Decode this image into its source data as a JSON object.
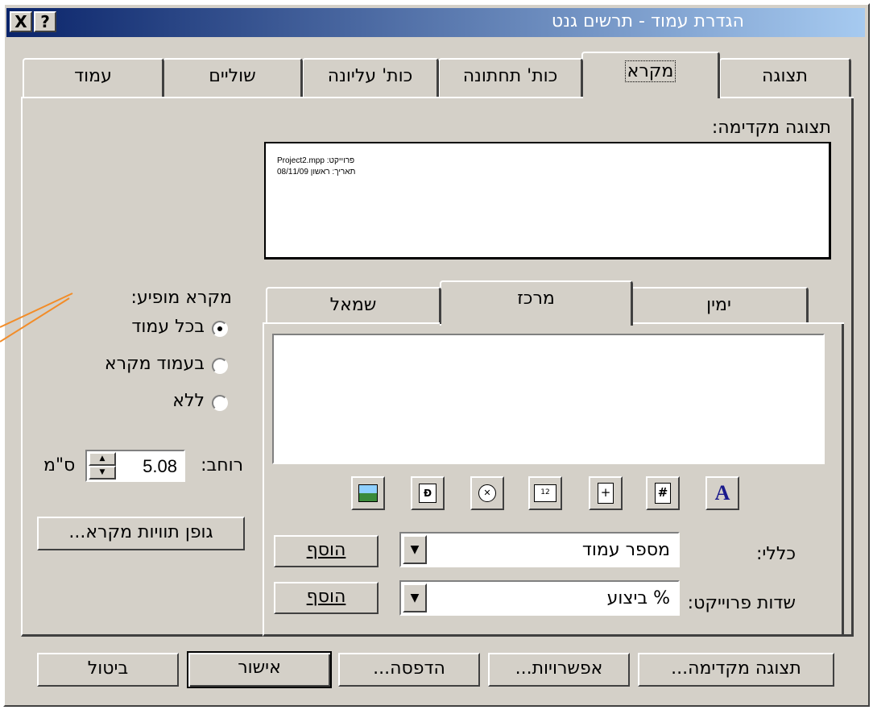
{
  "window": {
    "title": "הגדרת עמוד - תרשים גנט",
    "help_label": "?",
    "close_label": "X"
  },
  "tabs": [
    {
      "label": "תצוגה",
      "active": false
    },
    {
      "label": "מקרא",
      "active": true
    },
    {
      "label": "כות' תחתונה",
      "active": false
    },
    {
      "label": "כות' עליונה",
      "active": false
    },
    {
      "label": "שוליים",
      "active": false
    },
    {
      "label": "עמוד",
      "active": false
    }
  ],
  "preview": {
    "label": "תצוגה מקדימה:",
    "line1": "פרוייקט: Project2.mpp",
    "line2": "תאריך: ראשון 08/11/09"
  },
  "legend_on": {
    "label": "מקרא מופיע:",
    "options": [
      {
        "label": "בכל עמוד",
        "selected": true
      },
      {
        "label": "בעמוד מקרא",
        "selected": false
      },
      {
        "label": "ללא",
        "selected": false
      }
    ]
  },
  "width": {
    "label": "רוחב:",
    "value": "5.08",
    "unit": "ס\"מ"
  },
  "legend_font_button": "גופן תוויות מקרא...",
  "align_tabs": [
    {
      "label": "ימין",
      "active": false
    },
    {
      "label": "מרכז",
      "active": true
    },
    {
      "label": "שמאל",
      "active": false
    }
  ],
  "toolbar_icons": [
    "font-icon",
    "page-number-icon",
    "total-pages-icon",
    "date-icon",
    "time-icon",
    "file-name-icon",
    "picture-icon"
  ],
  "general": {
    "label": "כללי:",
    "value": "מספר עמוד",
    "add_label": "הוסף"
  },
  "project_fields": {
    "label": "שדות פרוייקט:",
    "value": "% ביצוע",
    "add_label": "הוסף"
  },
  "buttons": {
    "print_preview": "תצוגה מקדימה...",
    "options": "אפשרויות...",
    "print": "הדפסה...",
    "ok": "אישור",
    "cancel": "ביטול"
  },
  "colors": {
    "title_start": "#0a246a",
    "title_end": "#a6caf0",
    "face": "#d4d0c8",
    "annotation": "#f28c28"
  }
}
